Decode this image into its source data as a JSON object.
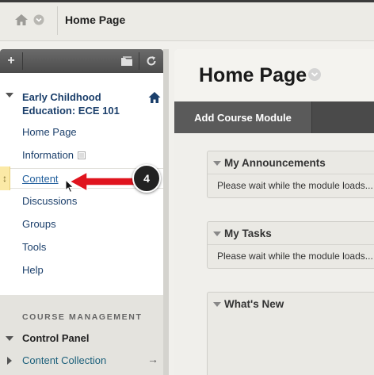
{
  "breadcrumb": {
    "current": "Home Page"
  },
  "course_menu": {
    "course_title": "Early Childhood Education: ECE 101",
    "items": [
      {
        "label": "Home Page"
      },
      {
        "label": "Information"
      },
      {
        "label": "Content"
      },
      {
        "label": "Discussions"
      },
      {
        "label": "Groups"
      },
      {
        "label": "Tools"
      },
      {
        "label": "Help"
      }
    ],
    "management": {
      "heading": "COURSE MANAGEMENT",
      "control_panel": "Control Panel",
      "content_collection": "Content Collection"
    }
  },
  "callout": {
    "step": "4"
  },
  "main": {
    "title": "Home Page",
    "add_module_label": "Add Course Module",
    "modules": [
      {
        "title": "My Announcements",
        "body": "Please wait while the module loads..."
      },
      {
        "title": "My Tasks",
        "body": "Please wait while the module loads..."
      },
      {
        "title": "What's New",
        "body": ""
      }
    ]
  },
  "colors": {
    "link": "#1b3f6b",
    "toolbar": "#4b4b4b",
    "callout_arrow": "#e0141e",
    "drag_highlight": "#fbe9a6"
  }
}
